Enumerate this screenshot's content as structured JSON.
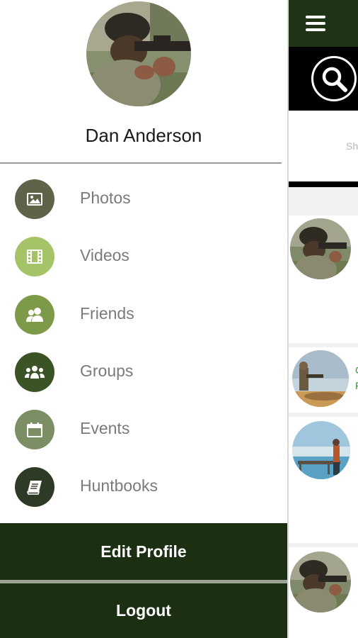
{
  "profile": {
    "name": "Dan Anderson",
    "avatar_icon": "hunter-aiming-rifle-photo"
  },
  "menu": {
    "items": [
      {
        "label": "Photos",
        "icon": "photo-icon",
        "color": "#5d6449"
      },
      {
        "label": "Videos",
        "icon": "film-icon",
        "color": "#a5c468"
      },
      {
        "label": "Friends",
        "icon": "friends-icon",
        "color": "#7d9a48"
      },
      {
        "label": "Groups",
        "icon": "groups-icon",
        "color": "#3b5426"
      },
      {
        "label": "Events",
        "icon": "calendar-icon",
        "color": "#7c8e63"
      },
      {
        "label": "Huntbooks",
        "icon": "book-icon",
        "color": "#2f3a26"
      }
    ]
  },
  "actions": {
    "edit_profile": "Edit Profile",
    "logout": "Logout"
  },
  "background_app": {
    "sort_text_fragment": "Sh",
    "colors": {
      "topbar": "#1f3317",
      "search_bar": "#000000",
      "link": "#2e9b2e"
    }
  }
}
